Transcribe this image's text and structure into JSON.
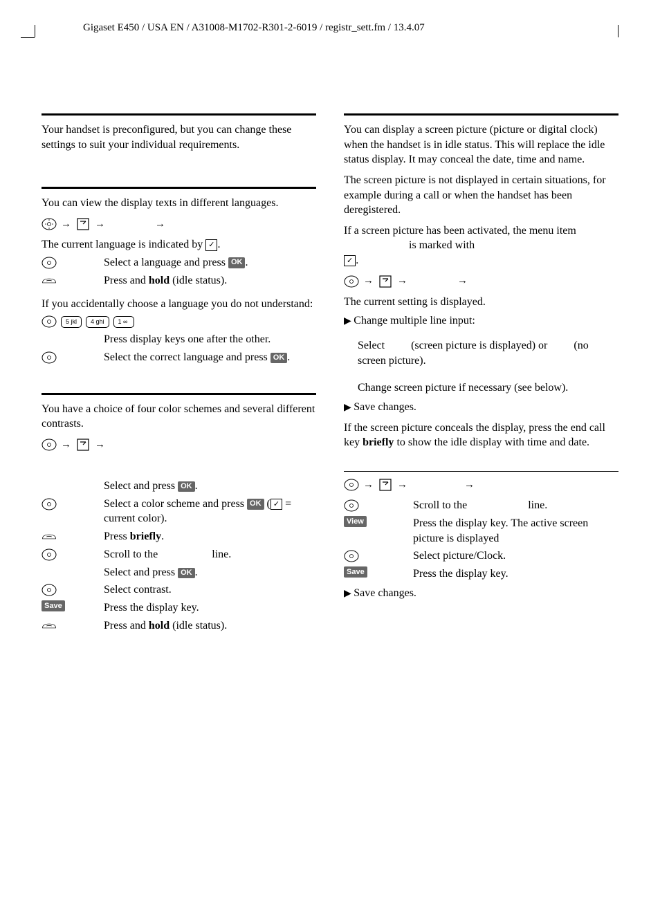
{
  "header": "Gigaset E450 / USA EN / A31008-M1702-R301-2-6019 / registr_sett.fm / 13.4.07",
  "left": {
    "intro": "Your handset is preconfigured, but you can change these settings to suit your individual requirements.",
    "lang": {
      "p1": "You can view the display texts in different languages.",
      "p2a": "The current language is indicated by ",
      "p2b": ".",
      "s1a": "Select a language and press ",
      "s1b": ".",
      "s2a": "Press and ",
      "s2b": "hold",
      "s2c": " (idle status).",
      "p3": "If you accidentally choose a language you do not understand:",
      "s3": "Press display keys one after the other.",
      "s4a": "Select the correct language and press ",
      "s4b": "."
    },
    "color": {
      "p1": "You have a choice of four color schemes and several different contrasts.",
      "s1a": "Select and press ",
      "s1b": ".",
      "s2a": "Select a color scheme and press ",
      "s2b": " (",
      "s2c": " = current color).",
      "s3a": "Press ",
      "s3b": "briefly",
      "s3c": ".",
      "s4a": "Scroll to the ",
      "s4b": " line.",
      "s5a": "Select and press ",
      "s5b": ".",
      "s6": "Select contrast.",
      "s7": "Press the display key.",
      "s8a": "Press and ",
      "s8b": "hold",
      "s8c": " (idle status)."
    }
  },
  "right": {
    "screen": {
      "p1": "You can display a screen picture (picture or digital clock) when the handset is in idle status. This will replace the idle status display. It may conceal the date, time and name.",
      "p2": "The screen picture is not displayed in certain situations, for example during a call or when the handset has been deregistered.",
      "p3a": "If a screen picture has been activated, the menu item ",
      "p3b": " is marked with ",
      "p3c": ".",
      "p4": "The current setting is displayed.",
      "b1": "Change multiple line input:",
      "s1a": "Select ",
      "s1b": " (screen picture is displayed) or ",
      "s1c": " (no screen picture).",
      "s2": "Change screen picture if necessary (see below).",
      "b2": "Save changes.",
      "p5a": "If the screen picture conceals the display, press the end call key ",
      "p5b": "briefly",
      "p5c": " to show the idle display with time and date."
    },
    "pic": {
      "s1a": "Scroll to the ",
      "s1b": " line.",
      "s2": "Press the display key. The active screen picture is displayed",
      "s3": "Select picture/Clock.",
      "s4": "Press the display key.",
      "b1": "Save changes."
    }
  },
  "keys": {
    "k5": "5 jkl",
    "k4": "4 ghi",
    "k1": "1 ∞"
  },
  "btn": {
    "ok": "OK",
    "save": "Save",
    "view": "View"
  },
  "check": "✓"
}
